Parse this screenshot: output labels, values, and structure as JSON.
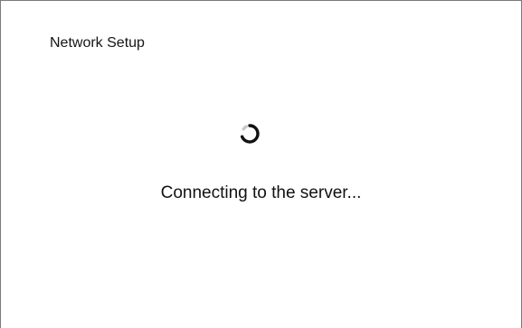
{
  "dialog": {
    "title": "Network Setup",
    "status_text": "Connecting to the server...",
    "spinner_icon": "loading-spinner-icon"
  }
}
